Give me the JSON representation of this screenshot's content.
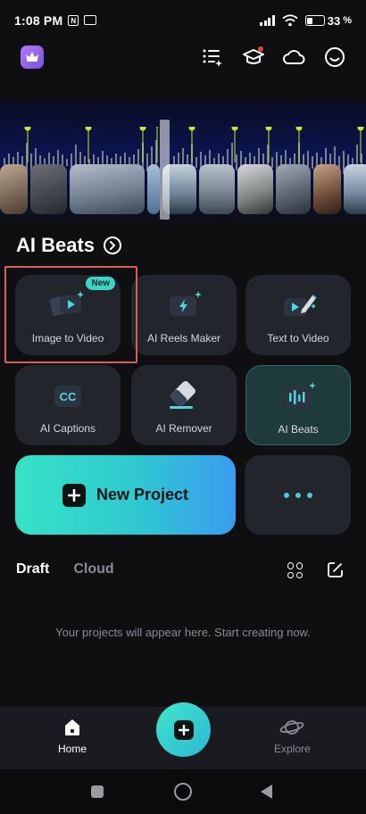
{
  "status_bar": {
    "time": "1:08 PM",
    "nfc_glyph": "N",
    "battery_percent": "33",
    "battery_level": 0.33
  },
  "header": {
    "icons": [
      "crown-icon",
      "task-list-icon",
      "graduation-cap-icon",
      "cloud-icon",
      "smiley-icon"
    ],
    "accent_color": "#9a63f0"
  },
  "section": {
    "title": "AI Beats"
  },
  "tools": [
    {
      "label": "Image to Video",
      "badge": "New",
      "icon": "image-to-video-icon"
    },
    {
      "label": "AI Reels Maker",
      "icon": "ai-reels-icon"
    },
    {
      "label": "Text to Video",
      "icon": "text-to-video-icon"
    },
    {
      "label": "AI Captions",
      "icon": "cc-icon"
    },
    {
      "label": "AI Remover",
      "icon": "eraser-icon"
    },
    {
      "label": "AI Beats",
      "icon": "music-beats-icon"
    }
  ],
  "new_project": {
    "label": "New Project"
  },
  "drafts": {
    "tabs": [
      "Draft",
      "Cloud"
    ],
    "empty_message": "Your projects will appear here. Start creating now."
  },
  "bottom_nav": {
    "home_label": "Home",
    "explore_label": "Explore"
  },
  "colors": {
    "background": "#0f0f12",
    "tile": "#23252c",
    "teal": "#36e3c6",
    "highlight": "#d9604d"
  }
}
